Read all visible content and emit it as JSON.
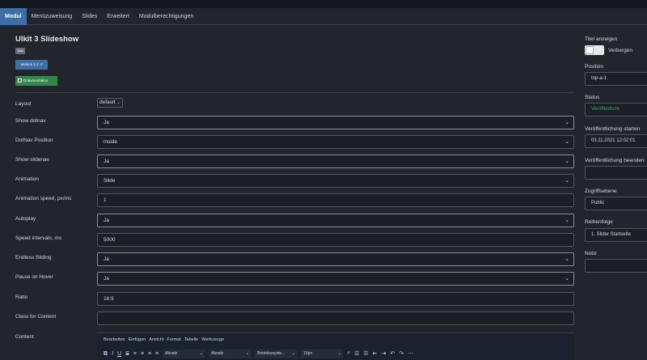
{
  "tabs": [
    "Modul",
    "Menüzuweisung",
    "Slides",
    "Erweitert",
    "Modulberechtigungen"
  ],
  "module": {
    "title": "UIkit 3 Slideshow",
    "site_badge": "Site",
    "version_label": "Version 1.2 ↗",
    "docs_label": "Dokumentation"
  },
  "fields": {
    "layout": {
      "label": "Layout",
      "value": "default"
    },
    "show_dotnav": {
      "label": "Show dotnav",
      "value": "Ja"
    },
    "dotnav_position": {
      "label": "DotNav Position",
      "value": "inside"
    },
    "show_slidenav": {
      "label": "Show slidenav",
      "value": "Ja"
    },
    "animation": {
      "label": "Animation",
      "value": "Slide"
    },
    "animation_speed": {
      "label": "Animation speed, px/ms",
      "value": "1"
    },
    "autoplay": {
      "label": "Autoplay",
      "value": "Ja"
    },
    "speed_intervals": {
      "label": "Speed intervals, ms",
      "value": "5000"
    },
    "endless_sliding": {
      "label": "Endless Sliding",
      "value": "Ja"
    },
    "pause_on_hover": {
      "label": "Pause on Hover",
      "value": "Ja"
    },
    "ratio": {
      "label": "Ratio",
      "value": "16:9"
    },
    "class_for_content": {
      "label": "Class for Content",
      "value": ""
    },
    "content": {
      "label": "Content"
    }
  },
  "editor": {
    "menu": [
      "Bearbeiten",
      "Einfügen",
      "Ansicht",
      "Format",
      "Tabelle",
      "Werkzeuge"
    ],
    "block_format": "Absatz",
    "block_format2": "Absatz",
    "font_family": "Betriebssyste...",
    "font_size": "16px"
  },
  "sidebar": {
    "show_title_label": "Titel anzeigen",
    "show_title_value": "Verbergen",
    "position_label": "Position",
    "position_value": "top-a-1",
    "status_label": "Status",
    "status_value": "Veröffentlicht",
    "publish_start_label": "Veröffentlichung starten",
    "publish_start_value": "03.11.2021 12:02:01",
    "publish_end_label": "Veröffentlichung beenden",
    "publish_end_value": "",
    "access_label": "Zugriffsebene",
    "access_value": "Public",
    "order_label": "Reihenfolge",
    "order_value": "1. Slider Startseite",
    "note_label": "Notiz",
    "note_value": ""
  }
}
